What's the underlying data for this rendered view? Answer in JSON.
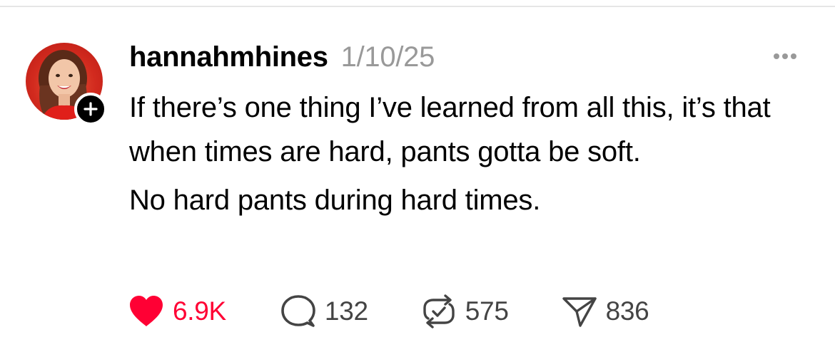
{
  "post": {
    "author": {
      "username": "hannahmhines",
      "avatar_icon": "profile-photo",
      "follow_icon": "plus-icon"
    },
    "timestamp": "1/10/25",
    "more_icon": "ellipsis-icon",
    "text": {
      "paragraph_1": "If there’s one thing I’ve learned from all this, it’s that when times are hard, pants gotta be soft.",
      "paragraph_2": "No hard pants during hard times."
    },
    "actions": {
      "likes": {
        "icon": "heart-icon",
        "count": "6.9K",
        "liked": true,
        "color": "#ff0034"
      },
      "replies": {
        "icon": "comment-icon",
        "count": "132"
      },
      "reposts": {
        "icon": "repost-icon",
        "count": "575"
      },
      "shares": {
        "icon": "send-icon",
        "count": "836"
      }
    }
  },
  "colors": {
    "text": "#000000",
    "muted": "#999999",
    "action_text": "#444444",
    "like": "#ff0034",
    "divider": "#e6e6e6"
  }
}
